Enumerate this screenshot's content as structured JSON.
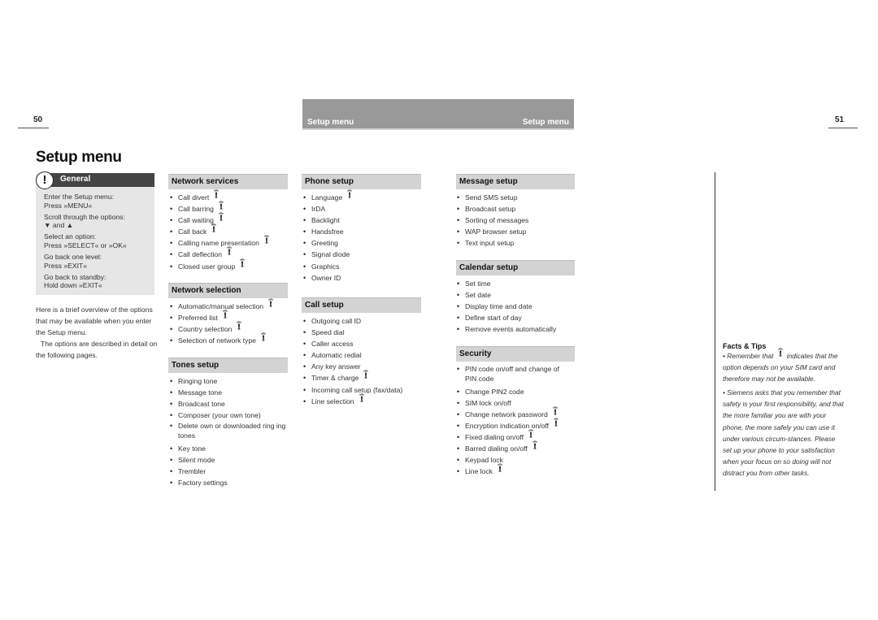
{
  "page_left": {
    "number": "50"
  },
  "page_right": {
    "number": "51"
  },
  "header_bar": {
    "left_label": "Setup menu",
    "right_label": "Setup menu"
  },
  "title": "Setup menu",
  "general": {
    "heading": "General",
    "icon": "exclamation-icon",
    "steps": [
      {
        "label": "Enter the Setup menu:",
        "action": "Press »MENU«"
      },
      {
        "label": "Scroll through the options:",
        "action": "▼ and ▲"
      },
      {
        "label": "Select an option:",
        "action": "Press »SELECT« or »OK«"
      },
      {
        "label": "Go back one level:",
        "action": "Press »EXIT«"
      },
      {
        "label": "Go back to standby:",
        "action": "Hold down »EXIT«"
      }
    ]
  },
  "intro": {
    "p1": "Here is a brief overview of the options that may be available when you enter the Setup menu.",
    "p2": "The options are described in detail on the following pages."
  },
  "sections": {
    "network_services": {
      "heading": "Network services",
      "items": [
        {
          "text": "Call divert",
          "sim": true
        },
        {
          "text": "Call barring",
          "sim": true
        },
        {
          "text": "Call waiting",
          "sim": true
        },
        {
          "text": "Call back",
          "sim": true
        },
        {
          "text": "Calling name presentation",
          "sim": true
        },
        {
          "text": "Call deflection",
          "sim": true
        },
        {
          "text": "Closed user group",
          "sim": true
        }
      ]
    },
    "network_selection": {
      "heading": "Network selection",
      "items": [
        {
          "text": "Automatic/manual selection",
          "sim": true
        },
        {
          "text": "Preferred list",
          "sim": true
        },
        {
          "text": "Country selection",
          "sim": true
        },
        {
          "text": "Selection of network type",
          "sim": true
        }
      ]
    },
    "tones_setup": {
      "heading": "Tones setup",
      "items": [
        {
          "text": "Ringing tone",
          "sim": false
        },
        {
          "text": "Message tone",
          "sim": false
        },
        {
          "text": "Broadcast tone",
          "sim": false
        },
        {
          "text": "Composer (your own tone)",
          "sim": false
        },
        {
          "text": "Delete own or downloaded ring ing tones",
          "sim": false
        },
        {
          "text": "Key tone",
          "sim": false
        },
        {
          "text": "Silent mode",
          "sim": false
        },
        {
          "text": "Trembler",
          "sim": false
        },
        {
          "text": "Factory settings",
          "sim": false
        }
      ]
    },
    "phone_setup": {
      "heading": "Phone setup",
      "items": [
        {
          "text": "Language",
          "sim": true
        },
        {
          "text": "IrDA",
          "sim": false
        },
        {
          "text": "Backlight",
          "sim": false
        },
        {
          "text": "Handsfree",
          "sim": false
        },
        {
          "text": "Greeting",
          "sim": false
        },
        {
          "text": "Signal diode",
          "sim": false
        },
        {
          "text": "Graphics",
          "sim": false
        },
        {
          "text": "Owner ID",
          "sim": false
        }
      ]
    },
    "call_setup": {
      "heading": "Call setup",
      "items": [
        {
          "text": "Outgoing call ID",
          "sim": false
        },
        {
          "text": "Speed dial",
          "sim": false
        },
        {
          "text": "Caller access",
          "sim": false
        },
        {
          "text": "Automatic redial",
          "sim": false
        },
        {
          "text": "Any key answer",
          "sim": false
        },
        {
          "text": "Timer & charge",
          "sim": true
        },
        {
          "text": "Incoming call setup (fax/data)",
          "sim": false
        },
        {
          "text": "Line selection",
          "sim": true
        }
      ]
    },
    "message_setup": {
      "heading": "Message setup",
      "items": [
        {
          "text": "Send SMS setup",
          "sim": false
        },
        {
          "text": "Broadcast setup",
          "sim": false
        },
        {
          "text": "Sorting of messages",
          "sim": false
        },
        {
          "text": "WAP browser setup",
          "sim": false
        },
        {
          "text": "Text input setup",
          "sim": false
        }
      ]
    },
    "calendar_setup": {
      "heading": "Calendar setup",
      "items": [
        {
          "text": "Set time",
          "sim": false
        },
        {
          "text": "Set date",
          "sim": false
        },
        {
          "text": "Display time and date",
          "sim": false
        },
        {
          "text": "Define start of day",
          "sim": false
        },
        {
          "text": "Remove events automatically",
          "sim": false
        }
      ]
    },
    "security": {
      "heading": "Security",
      "items": [
        {
          "text": "PIN code on/off and change of PIN code",
          "sim": false
        },
        {
          "text": "Change PIN2 code",
          "sim": false
        },
        {
          "text": "SIM lock on/off",
          "sim": false
        },
        {
          "text": "Change network password",
          "sim": true
        },
        {
          "text": "Encryption indication on/off",
          "sim": true
        },
        {
          "text": "Fixed dialing on/off",
          "sim": true
        },
        {
          "text": "Barred dialing on/off",
          "sim": true
        },
        {
          "text": "Keypad lock",
          "sim": false
        },
        {
          "text": "Line lock",
          "sim": true
        }
      ]
    }
  },
  "facts_tips": {
    "heading": "Facts & Tips",
    "tip1_before": "• Remember that",
    "tip1_after": "indicates that the option depends on your SIM card and therefore may not be available.",
    "tip2": "• Siemens asks that you remember that safety is your first responsibility, and that the more familiar you are with your phone, the more safely you can use it under various circum-stances.  Please set up your phone to your satisfaction when your focus on so doing will not distract you from other tasks."
  }
}
